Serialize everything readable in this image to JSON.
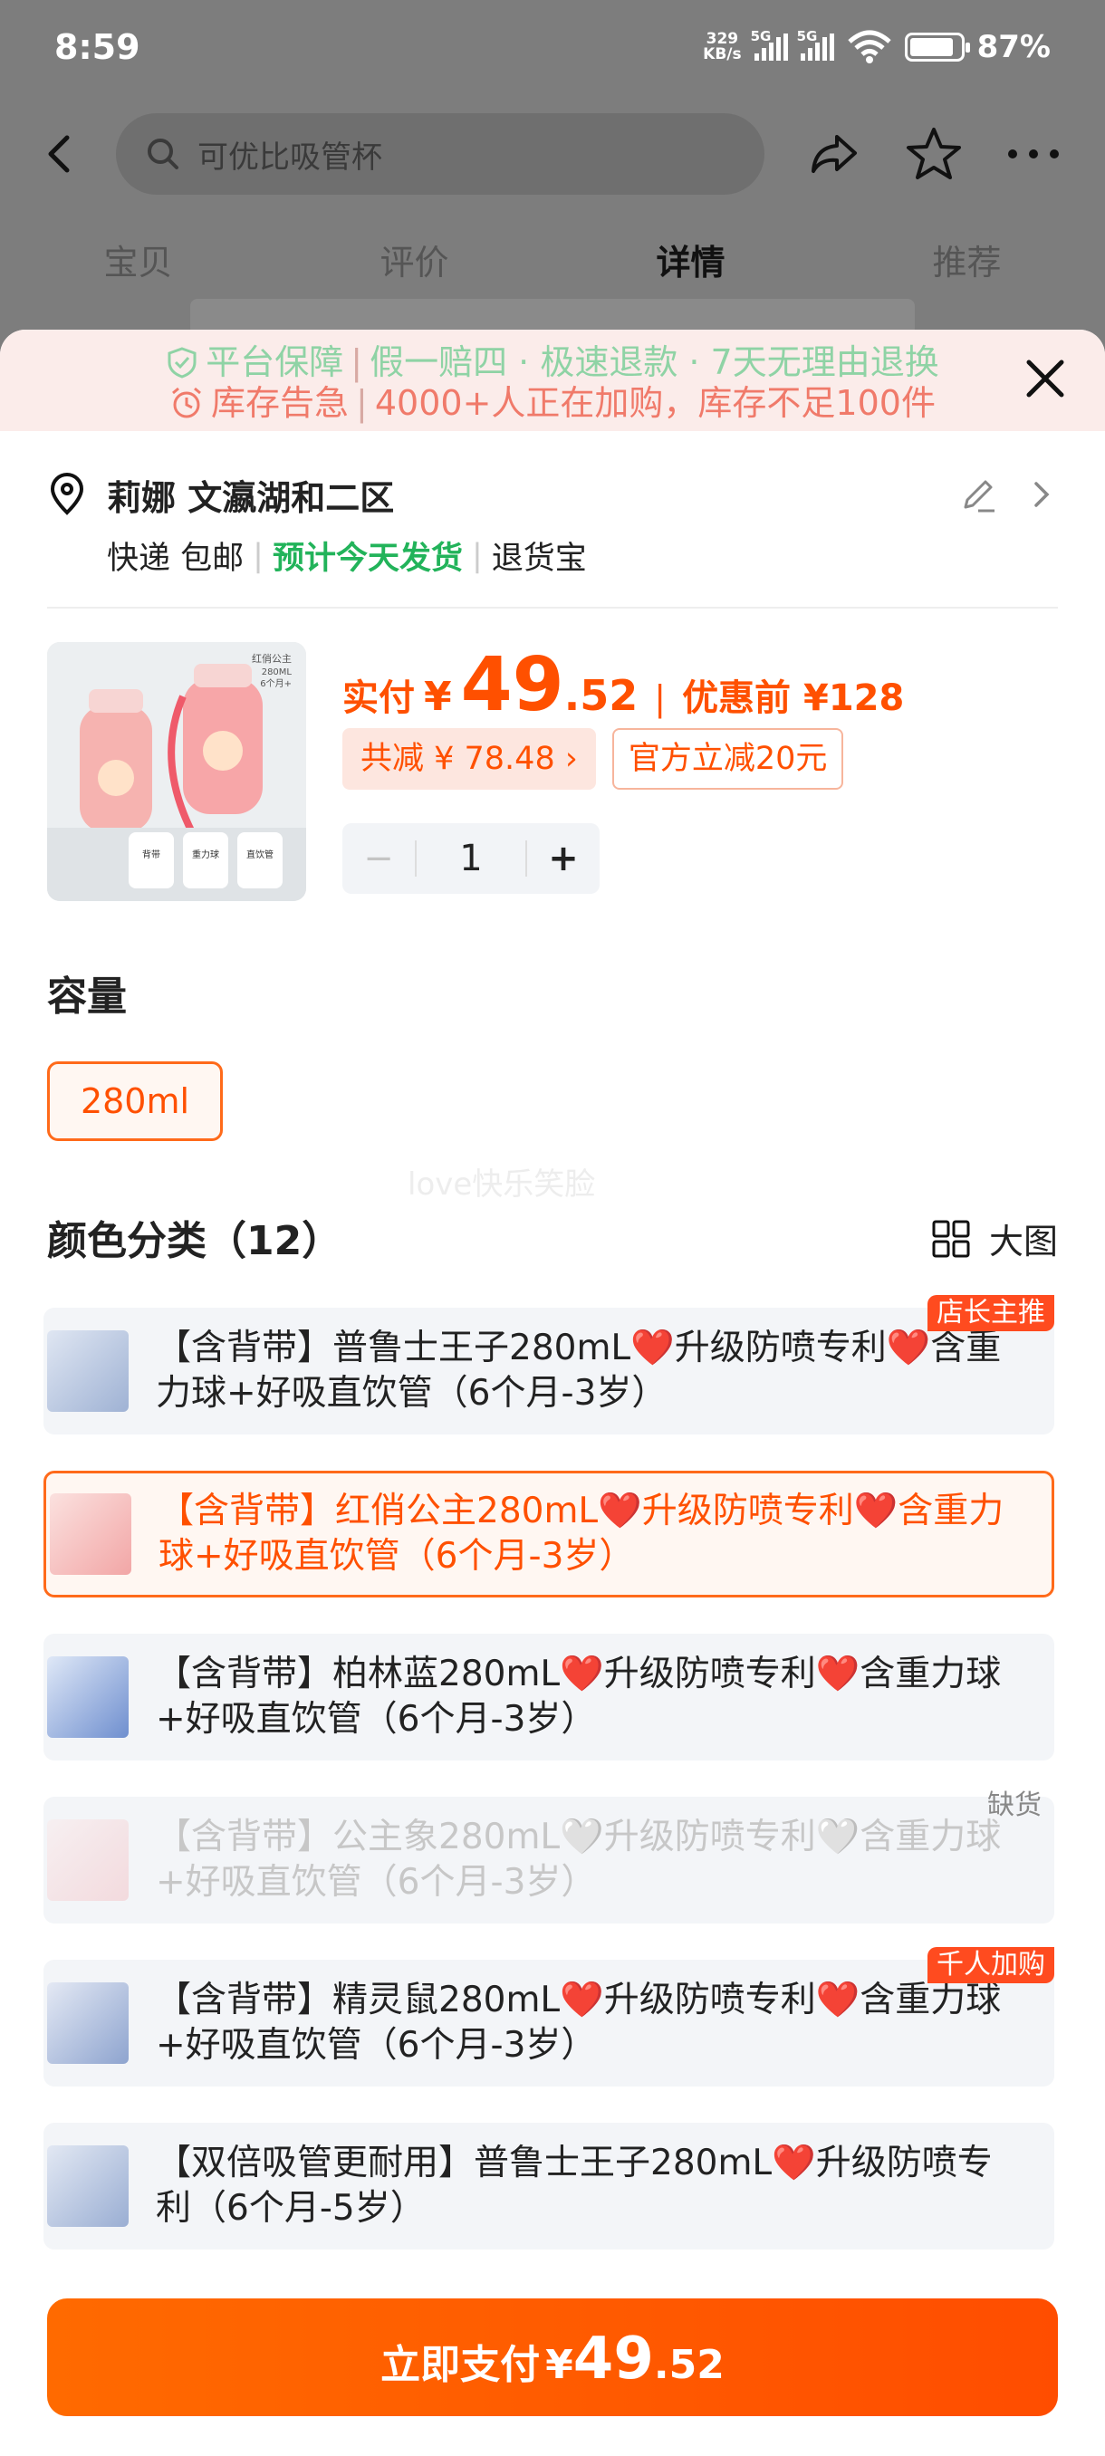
{
  "status": {
    "time": "8:59",
    "kbs_top": "329",
    "kbs_bottom": "KB/s",
    "net1": "5G",
    "net2": "5G",
    "battery_level": 0.87,
    "battery_pct": "87%"
  },
  "nav": {
    "search_placeholder": "可优比吸管杯",
    "back_icon": "back-arrow-icon",
    "share_icon": "share-icon",
    "star_icon": "star-icon",
    "more_icon": "more-icon"
  },
  "tabs": [
    "宝贝",
    "评价",
    "详情",
    "推荐"
  ],
  "banner": {
    "line1": [
      "平台保障",
      "假一赔四 · 极速退款 · 7天无理由退换"
    ],
    "line2": [
      "库存告急",
      "4000+人正在加购，库存不足100件"
    ]
  },
  "address": {
    "name": "莉娜 文瀛湖和二区",
    "ship1": "快递 包邮",
    "ship2": "预计今天发货",
    "ship3": "退货宝"
  },
  "product": {
    "pay_label": "实付",
    "yen": "¥",
    "price_int": "49",
    "price_dec": ".52",
    "vbar": "|",
    "before_label": "优惠前 ¥128",
    "discount": "共减 ¥ 78.48 ›",
    "coupon": "官方立减20元",
    "minus": "−",
    "qty": "1",
    "plus": "+",
    "thumb_text1": "红俏公主",
    "thumb_text2": "280ML",
    "thumb_text3": "6个月+",
    "thumb_lbl1": "背带",
    "thumb_lbl2": "重力球",
    "thumb_lbl3": "直饮管"
  },
  "capacity": {
    "title": "容量",
    "option": "280ml"
  },
  "watermark": "love快乐笑脸",
  "colors": {
    "title": "颜色分类（12）",
    "bigview": "大图",
    "items": [
      {
        "text": "【含背带】普鲁士王子280mL❤️升级防喷专利❤️含重力球+好吸直饮管（6个月-3岁）",
        "tag": "店长主推"
      },
      {
        "text": "【含背带】红俏公主280mL❤️升级防喷专利❤️含重力球+好吸直饮管（6个月-3岁）",
        "tag": ""
      },
      {
        "text": "【含背带】柏林蓝280mL❤️升级防喷专利❤️含重力球+好吸直饮管（6个月-3岁）",
        "tag": ""
      },
      {
        "text": "【含背带】公主象280mL🤍升级防喷专利🤍含重力球+好吸直饮管（6个月-3岁）",
        "tag": "缺货"
      },
      {
        "text": "【含背带】精灵鼠280mL❤️升级防喷专利❤️含重力球+好吸直饮管（6个月-3岁）",
        "tag": "千人加购"
      },
      {
        "text": "【双倍吸管更耐用】普鲁士王子280mL❤️升级防喷专利（6个月-5岁）",
        "tag": ""
      }
    ]
  },
  "pay": {
    "label": "立即支付",
    "yen": "¥",
    "int": "49",
    "dec": ".52"
  }
}
